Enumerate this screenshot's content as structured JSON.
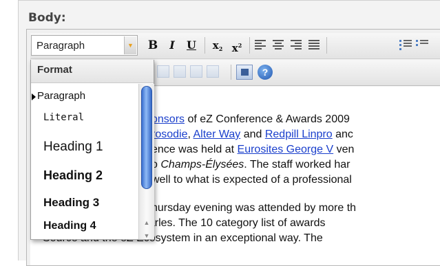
{
  "field_label": "Body:",
  "toolbar": {
    "format_value": "Paragraph",
    "bold": "B",
    "italic": "I",
    "underline": "U",
    "subscript": "x",
    "subscript_mark": "2",
    "superscript": "x",
    "superscript_mark": "2"
  },
  "toolbar2": {
    "help": "?"
  },
  "format_dropdown": {
    "header": "Format",
    "items": [
      "Paragraph",
      "Literal",
      "Heading 1",
      "Heading 2",
      "Heading 3",
      "Heading 4"
    ],
    "selected": "Paragraph"
  },
  "content": {
    "l1_link": "onsors",
    "l1_text": " of eZ Conference & Awards 2009",
    "l2_link1": "rosodie",
    "l2_sep": ", ",
    "l2_link2": "Alter Way",
    "l2_and": " and ",
    "l2_link3": "Redpill Linpro",
    "l2_tail": " anc",
    "l3_text": "ence was held at ",
    "l3_link": "Eurosites George V",
    "l3_tail": " ven",
    "l4_pre": "o ",
    "l4_em": "Champs-Élysées",
    "l4_tail": ". The staff worked har",
    "l5_text": "well to what is expected of a professional",
    "l6_text": "hursday evening was attended by more th",
    "l7_text": "years now, Marvin Charles. The 10 category list of awards",
    "l8_text": "Source and the eZ Ecosystem in an exceptional way. The"
  },
  "colors": {
    "link": "#1a3fcc",
    "scroll_thumb": "#3a6fd0"
  }
}
